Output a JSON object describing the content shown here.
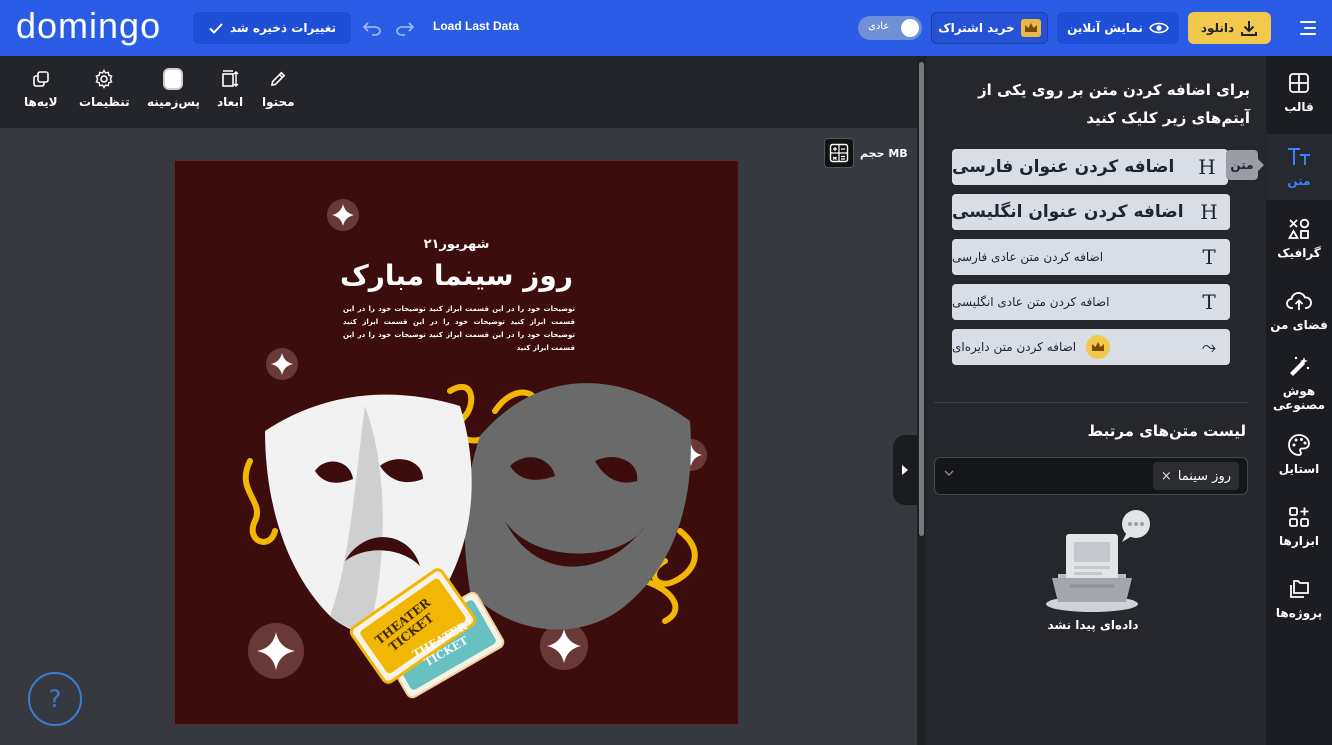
{
  "topbar": {
    "logo": "domingo",
    "saved_label": "تغییرات ذخیره شد",
    "load_last_label": "Load Last Data",
    "toggle_label": "عادی",
    "subscribe_label": "خرید اشتراک",
    "preview_label": "نمایش آنلاین",
    "download_label": "دانلود"
  },
  "toolbar": {
    "items": [
      {
        "label": "محتوا",
        "icon": "edit-pen-icon"
      },
      {
        "label": "ابعاد",
        "icon": "resize-icon"
      },
      {
        "label": "پس‌زمینه",
        "icon": "background-icon"
      },
      {
        "label": "تنظیمات",
        "icon": "gear-icon"
      },
      {
        "label": "لایه‌ها",
        "icon": "layers-icon"
      }
    ]
  },
  "canvas": {
    "size_label": "حجم MB",
    "poster": {
      "date": "۲۱شهریور",
      "title": "روز سینما مبارک",
      "description": "توضیحات خود را در این قسمت ابراز کنید توضیحات خود را در این قسمت ابراز کنید توضیحات خود را در این قسمت ابراز کنید توضیحات خود را در این قسمت ابراز کنید توضیحات خود را در این قسمت ابراز کنید",
      "ticket_text_1": "THEATER TICKET",
      "ticket_text_2": "THEATER TICKET",
      "background": "#3d0d0d"
    },
    "help_label": "?"
  },
  "panel": {
    "intro": "برای اضافه کردن متن بر روی یکی از آیتم‌های زیر کلیک کنید",
    "buttons": [
      {
        "label": "اضافه کردن عنوان فارسی",
        "glyph": "H"
      },
      {
        "label": "اضافه کردن عنوان انگلیسی",
        "glyph": "H"
      },
      {
        "label": "اضافه کردن متن عادی فارسی",
        "glyph": "T"
      },
      {
        "label": "اضافه کردن متن عادی انگلیسی",
        "glyph": "T"
      },
      {
        "label": "اضافه کردن متن دایره‌ای",
        "glyph": "⤳"
      }
    ],
    "tooltip": "متن",
    "related_title": "لیست متن‌های مرتبط",
    "select_chip": "روز سینما",
    "chip_remove": "×",
    "empty_text": "داده‌ای پیدا نشد"
  },
  "sidebar": {
    "items": [
      {
        "label": "قالب",
        "icon": "template-icon"
      },
      {
        "label": "متن",
        "icon": "text-icon"
      },
      {
        "label": "گرافیک",
        "icon": "shapes-icon"
      },
      {
        "label": "فضای من",
        "icon": "upload-cloud-icon"
      },
      {
        "label": "هوش مصنوعی",
        "icon": "magic-wand-icon"
      },
      {
        "label": "استایل",
        "icon": "palette-icon"
      },
      {
        "label": "ابزارها",
        "icon": "apps-icon"
      },
      {
        "label": "پروژه‌ها",
        "icon": "folders-icon"
      }
    ]
  },
  "colors": {
    "brand": "#2b5ce6",
    "accent_active": "#3b82f6",
    "download_bg": "#f2c94c",
    "panel_bg": "#25272c",
    "canvas_bg": "#373940"
  }
}
